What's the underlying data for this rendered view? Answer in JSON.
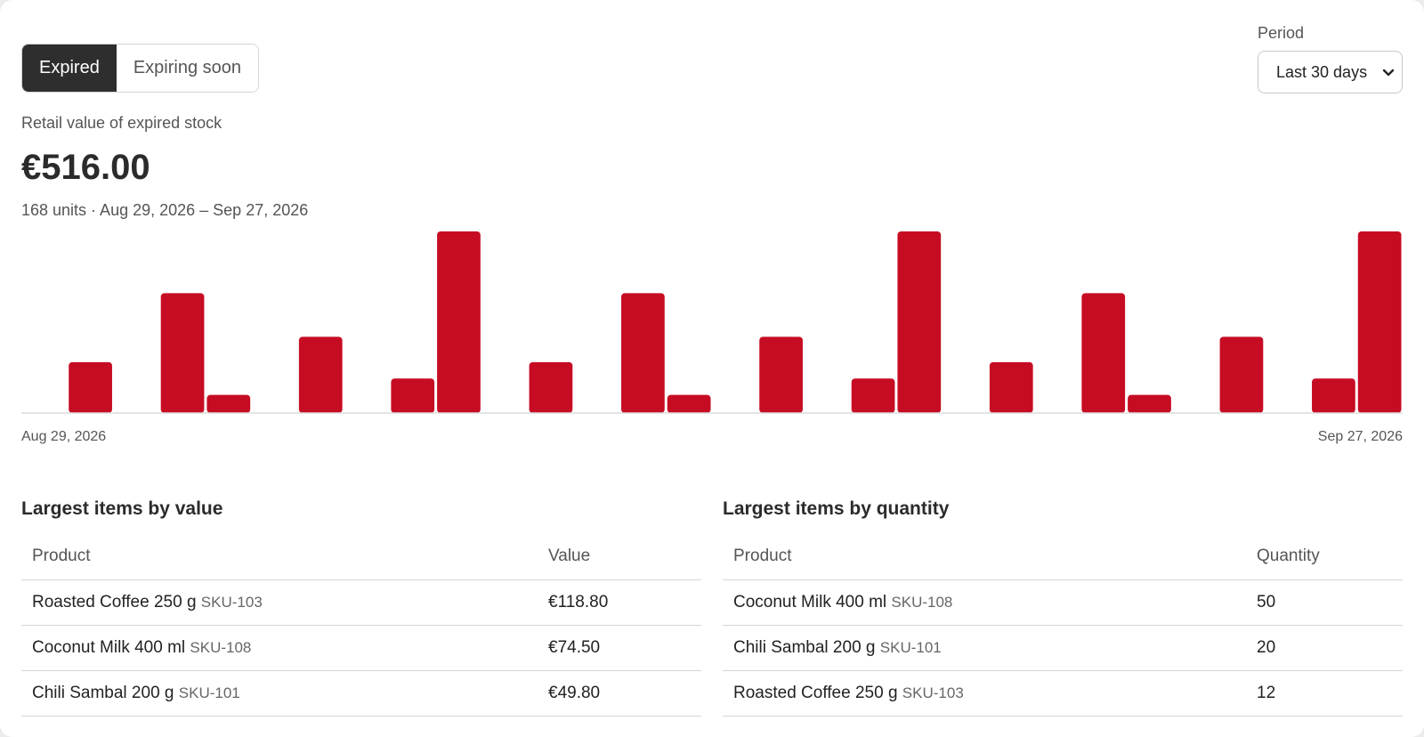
{
  "tabs": [
    {
      "label": "Expired",
      "active": true
    },
    {
      "label": "Expiring soon",
      "active": false
    }
  ],
  "period": {
    "label": "Period",
    "selected": "Last 30 days"
  },
  "summary": {
    "caption": "Retail value of expired stock",
    "value": "€516.00",
    "subline": "168 units · Aug 29, 2026 – Sep 27, 2026"
  },
  "chart_data": {
    "type": "bar",
    "color": "#c60c23",
    "x_start_label": "Aug 29, 2026",
    "x_end_label": "Sep 27, 2026",
    "values": [
      0,
      0.28,
      0,
      0.66,
      0.1,
      0,
      0.42,
      0,
      0.19,
      1.0,
      0,
      0.28,
      0,
      0.66,
      0.1,
      0,
      0.42,
      0,
      0.19,
      1.0,
      0,
      0.28,
      0,
      0.66,
      0.1,
      0,
      0.42,
      0,
      0.19,
      1.0
    ]
  },
  "by_value": {
    "title": "Largest items by value",
    "headers": [
      "Product",
      "Value"
    ],
    "rows": [
      {
        "product": "Roasted Coffee 250 g",
        "sku": "SKU-103",
        "value": "€118.80"
      },
      {
        "product": "Coconut Milk 400 ml",
        "sku": "SKU-108",
        "value": "€74.50"
      },
      {
        "product": "Chili Sambal 200 g",
        "sku": "SKU-101",
        "value": "€49.80"
      }
    ]
  },
  "by_quantity": {
    "title": "Largest items by quantity",
    "headers": [
      "Product",
      "Quantity"
    ],
    "rows": [
      {
        "product": "Coconut Milk 400 ml",
        "sku": "SKU-108",
        "value": "50"
      },
      {
        "product": "Chili Sambal 200 g",
        "sku": "SKU-101",
        "value": "20"
      },
      {
        "product": "Roasted Coffee 250 g",
        "sku": "SKU-103",
        "value": "12"
      }
    ]
  }
}
